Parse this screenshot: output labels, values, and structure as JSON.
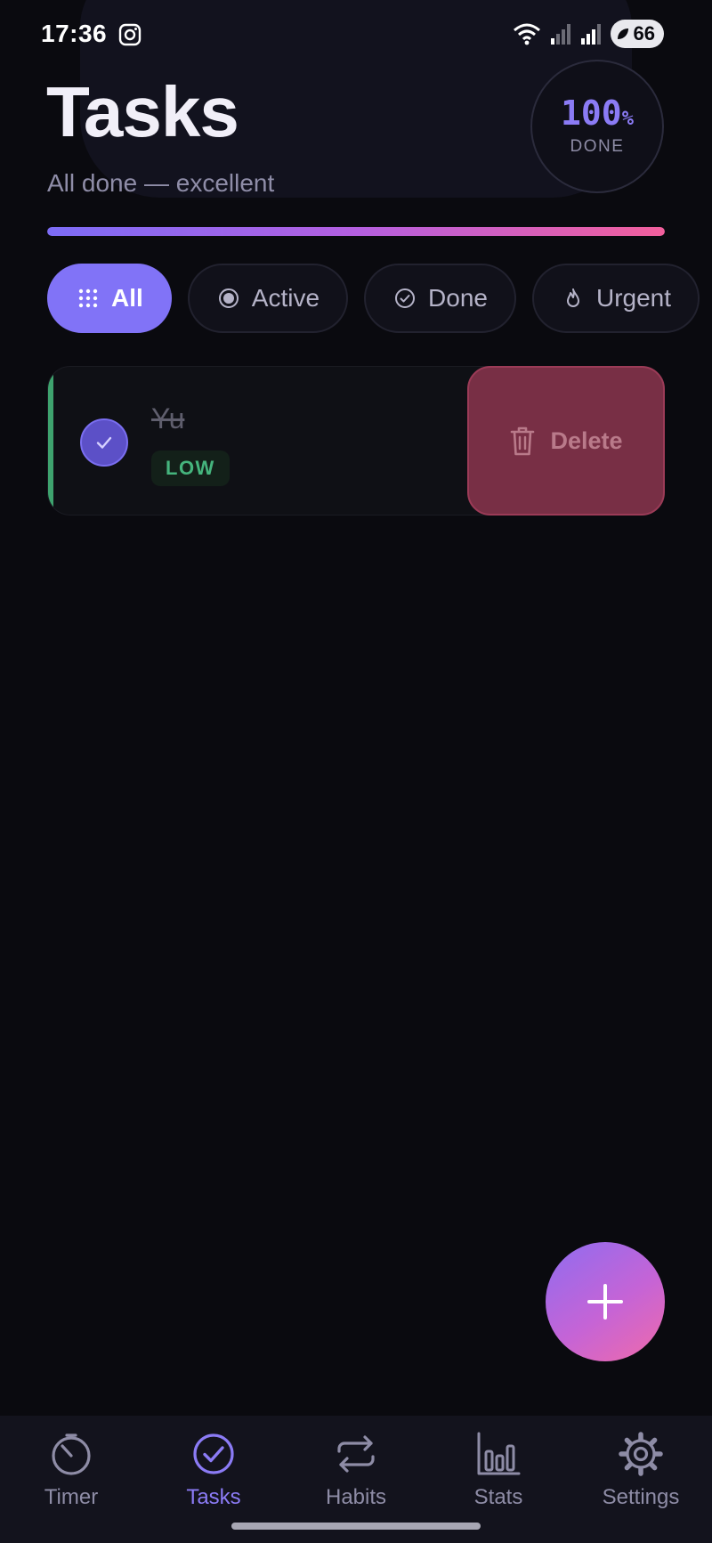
{
  "status_bar": {
    "time": "17:36",
    "battery": "66"
  },
  "header": {
    "title": "Tasks",
    "subtitle": "All done — excellent",
    "completion": {
      "value": "100",
      "unit": "%",
      "label": "DONE",
      "progress": 1.0
    }
  },
  "filters": [
    {
      "label": "All",
      "icon": "grid-icon",
      "selected": true
    },
    {
      "label": "Active",
      "icon": "radio-dot-icon",
      "selected": false
    },
    {
      "label": "Done",
      "icon": "check-circle-icon",
      "selected": false
    },
    {
      "label": "Urgent",
      "icon": "flame-icon",
      "selected": false
    }
  ],
  "tasks": [
    {
      "title": "Yu",
      "completed": true,
      "priority": "LOW",
      "swipe_action": {
        "label": "Delete",
        "icon": "trash-icon"
      }
    }
  ],
  "fab": {
    "icon": "plus-icon"
  },
  "nav": [
    {
      "label": "Timer",
      "icon": "timer-icon",
      "active": false
    },
    {
      "label": "Tasks",
      "icon": "check-circle-icon",
      "active": true
    },
    {
      "label": "Habits",
      "icon": "repeat-icon",
      "active": false
    },
    {
      "label": "Stats",
      "icon": "bar-chart-icon",
      "active": false
    },
    {
      "label": "Settings",
      "icon": "gear-icon",
      "active": false
    }
  ],
  "colors": {
    "background": "#0a0a0f",
    "accent": "#8173f7",
    "delete": "#782f45",
    "priority_low": "#45b47d"
  }
}
